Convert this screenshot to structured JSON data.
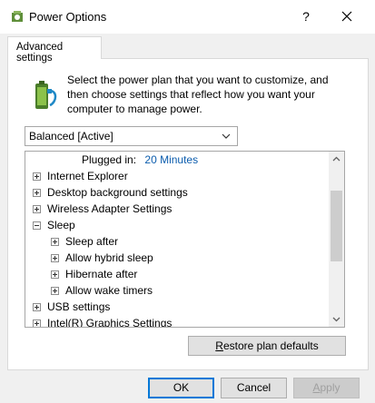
{
  "window": {
    "title": "Power Options",
    "help_label": "?",
    "close_label": "✕"
  },
  "tab": {
    "label": "Advanced settings"
  },
  "description": "Select the power plan that you want to customize, and then choose settings that reflect how you want your computer to manage power.",
  "plan_select": {
    "value": "Balanced [Active]"
  },
  "tree": {
    "plugged_in_label": "Plugged in:",
    "plugged_in_value": "20 Minutes",
    "items": [
      {
        "label": "Internet Explorer",
        "state": "collapsed"
      },
      {
        "label": "Desktop background settings",
        "state": "collapsed"
      },
      {
        "label": "Wireless Adapter Settings",
        "state": "collapsed"
      },
      {
        "label": "Sleep",
        "state": "expanded"
      },
      {
        "label": "Sleep after",
        "state": "collapsed"
      },
      {
        "label": "Allow hybrid sleep",
        "state": "collapsed"
      },
      {
        "label": "Hibernate after",
        "state": "collapsed"
      },
      {
        "label": "Allow wake timers",
        "state": "collapsed"
      },
      {
        "label": "USB settings",
        "state": "collapsed"
      },
      {
        "label": "Intel(R) Graphics Settings",
        "state": "collapsed"
      }
    ]
  },
  "buttons": {
    "restore_prefix": "",
    "restore_underlined": "R",
    "restore_rest": "estore plan defaults",
    "ok": "OK",
    "cancel": "Cancel",
    "apply_underlined": "A",
    "apply_rest": "pply"
  },
  "icons": {
    "app": "power-options-icon",
    "battery": "battery-plug-icon",
    "dropdown": "chevron-down-icon"
  },
  "colors": {
    "link_value": "#0b5cad",
    "focus_border": "#0078d7"
  }
}
